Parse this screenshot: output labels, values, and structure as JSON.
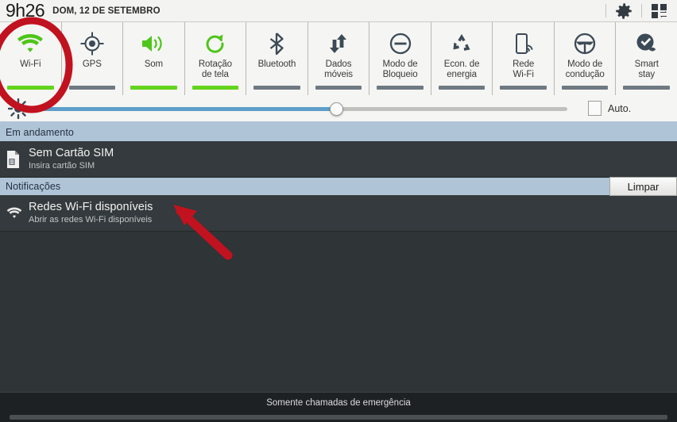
{
  "status_bar": {
    "clock": "9h26",
    "date": "DOM, 12 DE SETEMBRO",
    "settings_icon": "gear-icon",
    "toggles_grid_icon": "quick-toggle-grid-icon"
  },
  "quick_settings": {
    "tiles": [
      {
        "label": "Wi-Fi",
        "icon": "wifi-icon",
        "state": "on"
      },
      {
        "label": "GPS",
        "icon": "gps-crosshair-icon",
        "state": "off"
      },
      {
        "label": "Som",
        "icon": "sound-speaker-icon",
        "state": "on"
      },
      {
        "label": "Rotação\nde tela",
        "label_line1": "Rotação",
        "label_line2": "de tela",
        "icon": "screen-rotation-icon",
        "state": "on"
      },
      {
        "label": "Bluetooth",
        "icon": "bluetooth-icon",
        "state": "off"
      },
      {
        "label": "Dados\nmóveis",
        "label_line1": "Dados",
        "label_line2": "móveis",
        "icon": "mobile-data-arrows-icon",
        "state": "off"
      },
      {
        "label": "Modo de\nBloqueio",
        "label_line1": "Modo de",
        "label_line2": "Bloqueio",
        "icon": "blocking-mode-icon",
        "state": "off"
      },
      {
        "label": "Econ. de\nenergia",
        "label_line1": "Econ. de",
        "label_line2": "energia",
        "icon": "power-saving-recycle-icon",
        "state": "off"
      },
      {
        "label": "Rede\nWi-Fi",
        "label_line1": "Rede",
        "label_line2": "Wi-Fi",
        "icon": "wifi-hotspot-icon",
        "state": "off"
      },
      {
        "label": "Modo de\ncondução",
        "label_line1": "Modo de",
        "label_line2": "condução",
        "icon": "driving-mode-steering-wheel-icon",
        "state": "off"
      },
      {
        "label": "Smart\nstay",
        "label_line1": "Smart",
        "label_line2": "stay",
        "icon": "smart-stay-eye-icon",
        "state": "off"
      }
    ],
    "on_color": "#64d41c",
    "off_color": "#6d7a82"
  },
  "brightness": {
    "icon": "brightness-sun-icon",
    "value_percent": 56,
    "fill_color": "#5d9ec9",
    "auto_label": "Auto.",
    "auto_checked": false
  },
  "ongoing": {
    "header": "Em andamento",
    "items": [
      {
        "icon": "sim-card-missing-icon",
        "title": "Sem Cartão SIM",
        "subtitle": "Insira cartão SIM"
      }
    ]
  },
  "notifications": {
    "header": "Notificações",
    "clear_label": "Limpar",
    "items": [
      {
        "icon": "wifi-available-icon",
        "title": "Redes Wi-Fi disponíveis",
        "subtitle": "Abrir as redes Wi-Fi disponíveis"
      }
    ]
  },
  "bottom_bar": {
    "emergency_text": "Somente chamadas de emergência"
  },
  "annotations": {
    "circle_color": "#c1121f",
    "arrow_color": "#c1121f",
    "circle_target": "Wi-Fi",
    "arrow_target": "Redes Wi-Fi disponíveis"
  }
}
